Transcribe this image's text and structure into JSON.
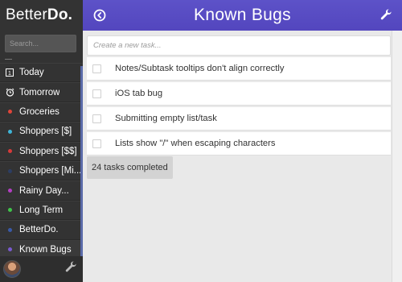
{
  "app": {
    "logo_light": "Better",
    "logo_bold": "Do."
  },
  "search": {
    "placeholder": "Search..."
  },
  "sidebar": {
    "items": [
      {
        "label": "Today",
        "icon": "calendar-icon"
      },
      {
        "label": "Tomorrow",
        "icon": "alarm-clock-icon"
      },
      {
        "label": "Groceries",
        "icon": "dot",
        "color": "#e0453a"
      },
      {
        "label": "Shoppers [$]",
        "icon": "dot",
        "color": "#3fb5d8"
      },
      {
        "label": "Shoppers [$$]",
        "icon": "dot",
        "color": "#d63a3a"
      },
      {
        "label": "Shoppers [Mi...",
        "icon": "dot",
        "color": "#2c3e63"
      },
      {
        "label": "Rainy Day...",
        "icon": "dot",
        "color": "#b43fc4"
      },
      {
        "label": "Long Term",
        "icon": "dot",
        "color": "#3fc44a"
      },
      {
        "label": "BetterDo.",
        "icon": "dot",
        "color": "#3a5aa8"
      },
      {
        "label": "Known Bugs",
        "icon": "dot",
        "color": "#7a5ad0"
      }
    ]
  },
  "header": {
    "title": "Known Bugs"
  },
  "new_task": {
    "placeholder": "Create a new task..."
  },
  "tasks": [
    {
      "text": "Notes/Subtask tooltips don't align correctly"
    },
    {
      "text": "iOS tab bug"
    },
    {
      "text": "Submitting empty list/task"
    },
    {
      "text": "Lists show \"/\" when escaping characters"
    }
  ],
  "completed": {
    "label": "24 tasks completed"
  },
  "colors": {
    "header": "#5a4fc4",
    "sidebar": "#333333",
    "background": "#e9e9e9"
  }
}
